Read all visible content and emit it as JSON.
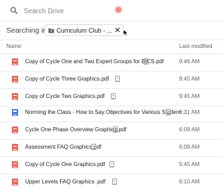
{
  "search": {
    "placeholder": "Search Drive"
  },
  "filter": {
    "label": "Searching in",
    "folder_chip": "Curriculum Club - ...",
    "close_glyph": "✕"
  },
  "columns": {
    "name": "Name",
    "last_modified": "Last modified"
  },
  "files": [
    {
      "name": "Copy of Cycle One and Two Expert Groups for BICS.pdf",
      "type": "pdf",
      "modified": "9:46 AM"
    },
    {
      "name": "Copy of Cycle Three Graphics.pdf",
      "type": "pdf",
      "modified": "9:45 AM"
    },
    {
      "name": "Copy of Cycle Two Graphics.pdf",
      "type": "pdf",
      "modified": "9:45 AM"
    },
    {
      "name": "Norming the Class - How to Say Objectives for Various Student ...",
      "type": "doc",
      "modified": "6:31 AM"
    },
    {
      "name": "Cycle One Phase Overview Graphics.pdf",
      "type": "pdf",
      "modified": "6:09 AM"
    },
    {
      "name": "Assessment FAQ Graphics.pdf",
      "type": "pdf",
      "modified": "6:09 AM"
    },
    {
      "name": "Copy of Cycle One Graphics.pdf",
      "type": "pdf",
      "modified": "5:45 AM"
    },
    {
      "name": "Upper Levels FAQ Graphics .pdf",
      "type": "pdf",
      "modified": "6:10 AM"
    }
  ],
  "colors": {
    "pdf_icon": "#e46a5f",
    "doc_icon": "#4e7ce0",
    "divider": "#e8eaed"
  }
}
